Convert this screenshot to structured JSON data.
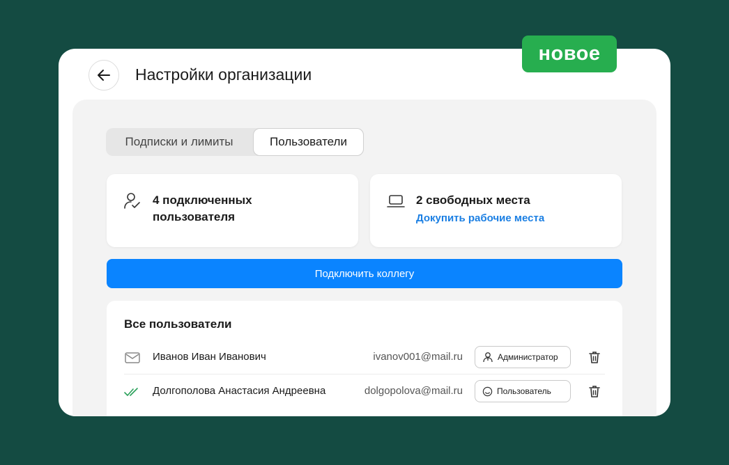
{
  "badge": "новое",
  "header": {
    "title": "Настройки организации"
  },
  "tabs": [
    {
      "label": "Подписки и лимиты"
    },
    {
      "label": "Пользователи"
    }
  ],
  "stats": {
    "connected": {
      "title": "4 подключенных пользователя"
    },
    "seats": {
      "title": "2 свободных места",
      "link": "Докупить рабочие места"
    }
  },
  "connect_button": "Подключить коллегу",
  "users": {
    "title": "Все пользователи",
    "rows": [
      {
        "name": "Иванов Иван Иванович",
        "email": "ivanov001@mail.ru",
        "role": "Администратор",
        "status_icon": "envelope-icon"
      },
      {
        "name": "Долгополова Анастасия Андреевна",
        "email": "dolgopolova@mail.ru",
        "role": "Пользователь",
        "status_icon": "double-check-icon"
      }
    ]
  },
  "colors": {
    "background": "#144b42",
    "badge": "#27ae4f",
    "primary": "#0a84ff",
    "link": "#1b7fe3"
  }
}
